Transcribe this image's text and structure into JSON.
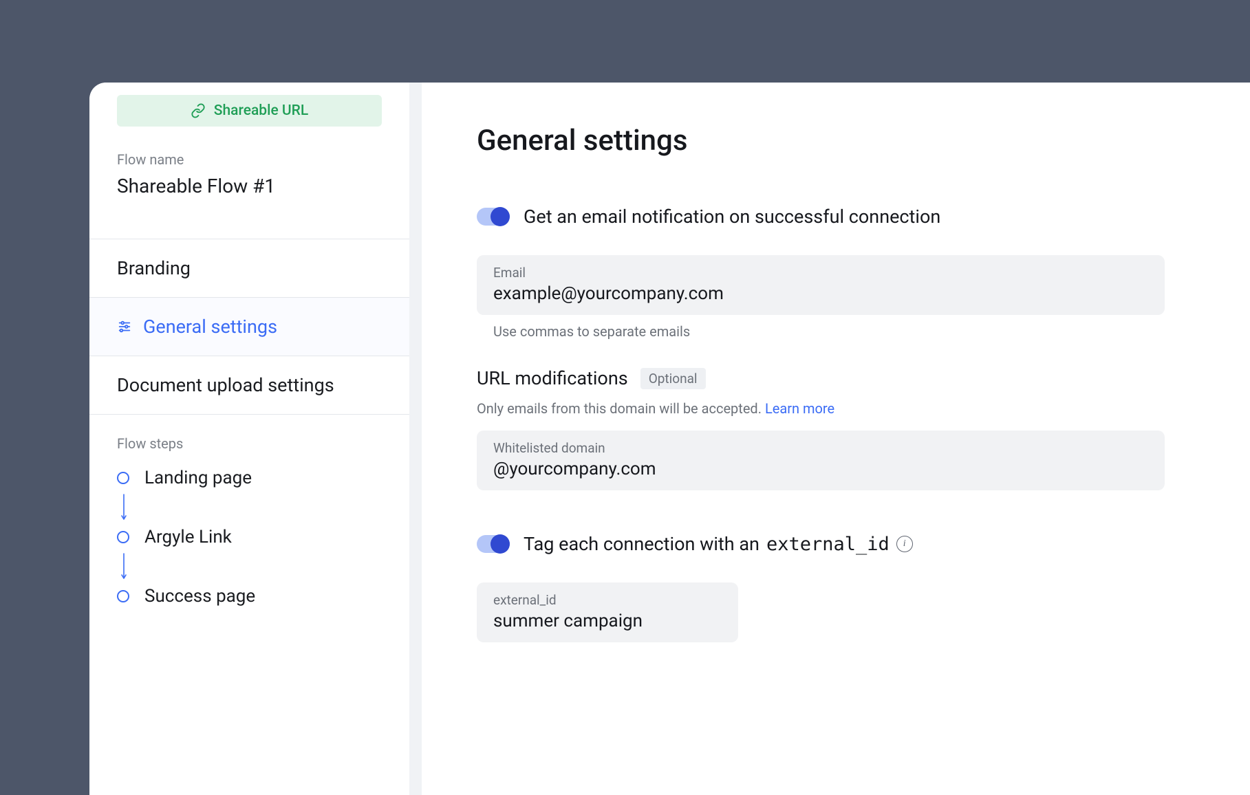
{
  "sidebar": {
    "badge_label": "Shareable URL",
    "flow_name_label": "Flow name",
    "flow_name_value": "Shareable Flow #1",
    "nav": {
      "branding": "Branding",
      "general_settings": "General settings",
      "document_upload_settings": "Document upload settings"
    },
    "flow_steps_label": "Flow steps",
    "steps": {
      "step1": "Landing page",
      "step2": "Argyle Link",
      "step3": "Success page"
    }
  },
  "main": {
    "title": "General settings",
    "email_toggle_label": "Get an email notification on successful connection",
    "email_field_label": "Email",
    "email_field_value": "example@yourcompany.com",
    "email_hint": "Use commas to separate emails",
    "url_mod_title": "URL modifications",
    "url_mod_optional": "Optional",
    "url_mod_desc_pre": "Only emails from this domain will be accepted. ",
    "url_mod_learn_more": "Learn more",
    "whitelist_label": "Whitelisted domain",
    "whitelist_value": "@yourcompany.com",
    "tag_toggle_pre": "Tag each connection with an ",
    "tag_toggle_code": "external_id",
    "external_id_label": "external_id",
    "external_id_value": "summer campaign"
  }
}
